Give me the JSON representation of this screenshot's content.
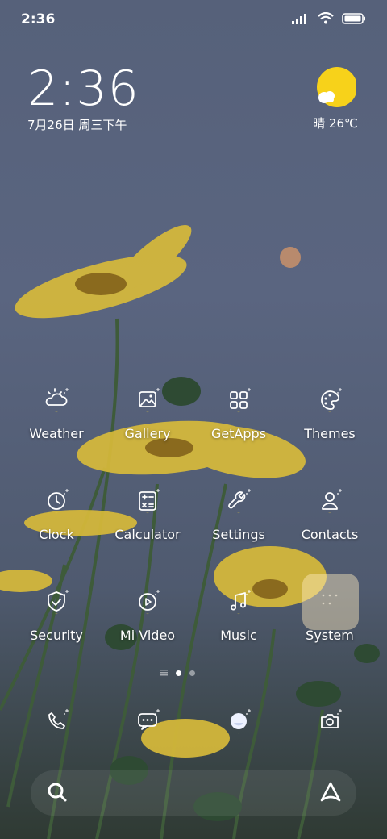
{
  "status_bar": {
    "time": "2:36"
  },
  "clock_widget": {
    "time": "2:36",
    "date": "7月26日 周三下午"
  },
  "weather_widget": {
    "text": "晴 26℃",
    "icon": "sunny-partly-cloudy-icon"
  },
  "apps": [
    {
      "name": "Weather",
      "icon": "weather-icon"
    },
    {
      "name": "Gallery",
      "icon": "gallery-icon"
    },
    {
      "name": "GetApps",
      "icon": "getapps-icon"
    },
    {
      "name": "Themes",
      "icon": "themes-icon"
    },
    {
      "name": "Clock",
      "icon": "clock-icon"
    },
    {
      "name": "Calculator",
      "icon": "calculator-icon"
    },
    {
      "name": "Settings",
      "icon": "settings-icon"
    },
    {
      "name": "Contacts",
      "icon": "contacts-icon"
    },
    {
      "name": "Security",
      "icon": "security-icon"
    },
    {
      "name": "Mi Video",
      "icon": "mi-video-icon"
    },
    {
      "name": "Music",
      "icon": "music-icon"
    },
    {
      "name": "System",
      "icon": "system-folder-icon"
    }
  ],
  "page_indicator": {
    "pages": 2,
    "current": 1
  },
  "hotseat": [
    {
      "icon": "phone-icon"
    },
    {
      "icon": "messages-icon"
    },
    {
      "icon": "browser-icon"
    },
    {
      "icon": "camera-icon"
    }
  ],
  "search_bar": {
    "icon": "search-icon",
    "assistant_icon": "assistant-icon"
  }
}
